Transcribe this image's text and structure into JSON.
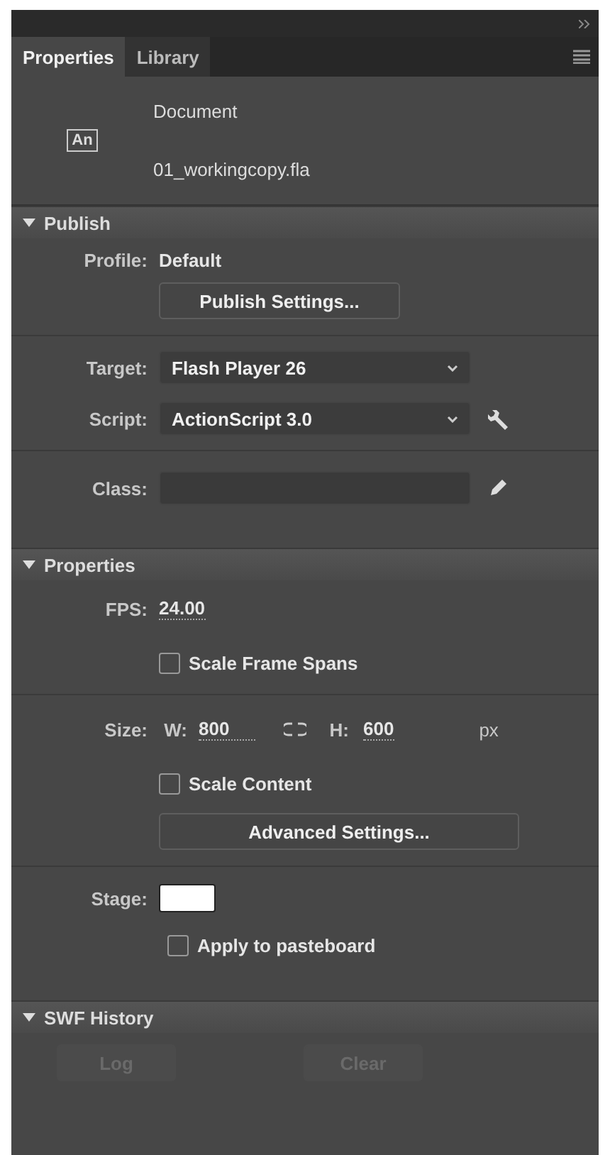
{
  "tabs": [
    {
      "label": "Properties",
      "selected": true
    },
    {
      "label": "Library",
      "selected": false
    }
  ],
  "document": {
    "icon_label": "An",
    "title": "Document",
    "filename": "01_workingcopy.fla"
  },
  "publish": {
    "title": "Publish",
    "expanded": true,
    "profile_label": "Profile:",
    "profile_value": "Default",
    "settings_button": "Publish Settings...",
    "target_label": "Target:",
    "target_value": "Flash Player 26",
    "script_label": "Script:",
    "script_value": "ActionScript 3.0",
    "class_label": "Class:"
  },
  "properties": {
    "title": "Properties",
    "expanded": true,
    "fps_label": "FPS:",
    "fps_value": "24.00",
    "scale_frame_spans": {
      "label": "Scale Frame Spans",
      "checked": false
    },
    "size_label": "Size:",
    "width_label": "W:",
    "width_value": "800",
    "height_label": "H:",
    "height_value": "600",
    "unit": "px",
    "scale_content": {
      "label": "Scale Content",
      "checked": false
    },
    "advanced_button": "Advanced Settings...",
    "stage_label": "Stage:",
    "stage_swatch": {
      "color": "#ffffff"
    },
    "apply_to_pasteboard": {
      "label": "Apply to pasteboard",
      "checked": false
    }
  },
  "swf_history": {
    "title": "SWF History",
    "expanded": true,
    "buttons": [
      {
        "label": "Log",
        "disabled": true
      },
      {
        "label": "Clear",
        "disabled": true
      }
    ]
  }
}
